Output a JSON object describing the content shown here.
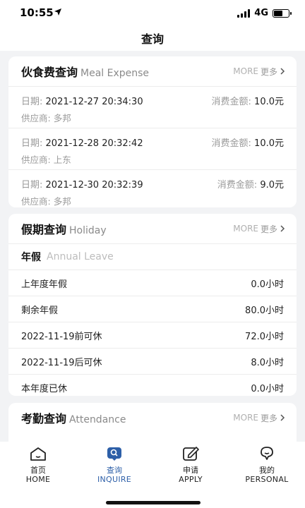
{
  "status_bar": {
    "time": "10:55",
    "network": "4G",
    "battery_level": 0.55
  },
  "header": {
    "title": "查询"
  },
  "meal": {
    "title": "伙食费查询",
    "title_en": "Meal Expense",
    "more_en": "MORE",
    "more_cn": "更多",
    "date_label": "日期:",
    "amount_label": "消费金额:",
    "supplier_label": "供应商:",
    "records": [
      {
        "date": "2021-12-27 20:34:30",
        "amount": "10.0元",
        "supplier": "多邦"
      },
      {
        "date": "2021-12-28 20:32:42",
        "amount": "10.0元",
        "supplier": "上东"
      },
      {
        "date": "2021-12-30 20:32:39",
        "amount": "9.0元",
        "supplier": "多邦"
      }
    ]
  },
  "holiday": {
    "title": "假期查询",
    "title_en": "Holiday",
    "more_en": "MORE",
    "more_cn": "更多",
    "annual_title": "年假",
    "annual_title_en": "Annual Leave",
    "rows": [
      {
        "label": "上年度年假",
        "value": "0.0小时"
      },
      {
        "label": "剩余年假",
        "value": "80.0小时"
      },
      {
        "label": "2022-11-19前可休",
        "value": "72.0小时"
      },
      {
        "label": "2022-11-19后可休",
        "value": "8.0小时"
      },
      {
        "label": "本年度已休",
        "value": "0.0小时"
      }
    ]
  },
  "attendance": {
    "title": "考勤查询",
    "title_en": "Attendance",
    "more_en": "MORE",
    "more_cn": "更多"
  },
  "tabbar": {
    "active_color": "#2d5fa8",
    "tabs": [
      {
        "cn": "首页",
        "en": "HOME",
        "icon": "home-icon"
      },
      {
        "cn": "查询",
        "en": "INQUIRE",
        "icon": "inquire-icon",
        "active": true
      },
      {
        "cn": "申请",
        "en": "APPLY",
        "icon": "edit-icon"
      },
      {
        "cn": "我的",
        "en": "PERSONAL",
        "icon": "person-icon"
      }
    ]
  }
}
